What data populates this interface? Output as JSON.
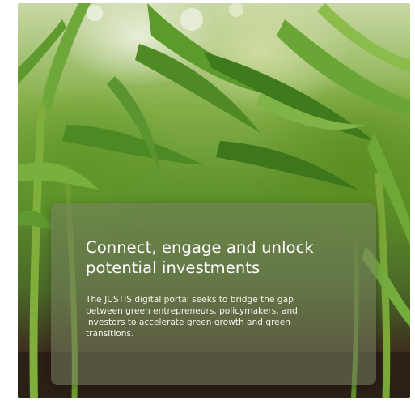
{
  "hero": {
    "image": "corn-field-photo",
    "headline": "Connect, engage and unlock potential investments",
    "description": "The JUSTIS digital portal seeks to bridge the gap between green entrepreneurs, policymakers, and investors to accelerate green growth and green transitions."
  },
  "colors": {
    "leaf": "#6fa83a",
    "soil": "#2a1f14",
    "text": "#ffffff"
  }
}
